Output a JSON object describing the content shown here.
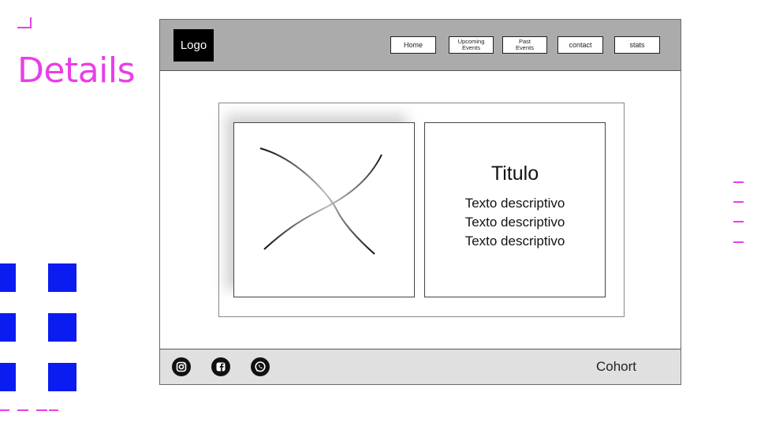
{
  "slide": {
    "title": "Details",
    "accent_color": "#e83fe8",
    "square_color": "#0a1cf0"
  },
  "header": {
    "logo_text": "Logo",
    "nav": [
      {
        "label": "Home"
      },
      {
        "label": "Upcoming\nEvents"
      },
      {
        "label": "Past\nEvents"
      },
      {
        "label": "contact"
      },
      {
        "label": "stats"
      }
    ]
  },
  "card": {
    "image_icon": "image-placeholder-icon",
    "title": "Titulo",
    "lines": [
      "Texto descriptivo",
      "Texto descriptivo",
      "Texto descriptivo"
    ]
  },
  "footer": {
    "social_icons": [
      "instagram-icon",
      "facebook-icon",
      "whatsapp-icon"
    ],
    "cohort_label": "Cohort"
  }
}
